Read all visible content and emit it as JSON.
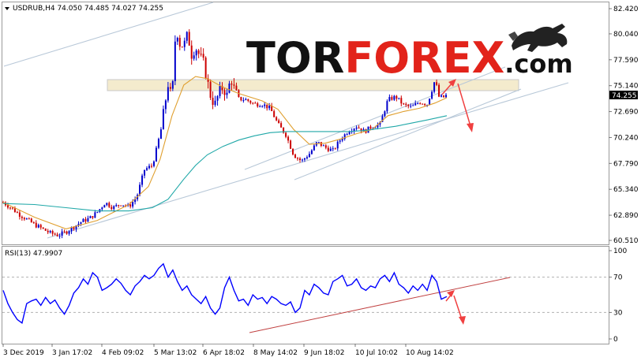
{
  "header": {
    "symbol_line": "USDRUB,H4  74.050 74.485 74.027 74.255",
    "rsi_label": "RSI(13) 47.9907"
  },
  "logo": {
    "part1": "TOR",
    "part2": "FOREX",
    "part3": ".com",
    "brand_color": "#e2231a"
  },
  "colors": {
    "bull_candle": "#0000cc",
    "bear_candle": "#cc0000",
    "ma_fast": "#e0a030",
    "ma_slow": "#20a8a8",
    "trendline": "#b8c8d8",
    "rsi_line": "#0000ff",
    "rsi_trend": "#c04040",
    "arrow": "#f04040",
    "resistance_zone": "#f0dca0",
    "current_price_bg": "#000000"
  },
  "chart_data": [
    {
      "type": "candlestick",
      "symbol": "USDRUB",
      "timeframe": "H4",
      "ohlc_last": {
        "open": 74.05,
        "high": 74.485,
        "low": 74.027,
        "close": 74.255
      },
      "current_price": "74.255",
      "y_ticks": [
        "82.420",
        "80.040",
        "77.590",
        "75.140",
        "72.690",
        "70.240",
        "67.790",
        "65.340",
        "62.890",
        "60.510"
      ],
      "ylim": [
        60.51,
        82.42
      ],
      "x_ticks": [
        "3 Dec 2019",
        "3 Jan 17:02",
        "4 Feb 09:02",
        "5 Mar 13:02",
        "6 Apr 18:02",
        "8 May 14:02",
        "9 Jun 18:02",
        "10 Jul 10:02",
        "10 Aug 14:02"
      ],
      "close_path": [
        [
          0,
          64.1
        ],
        [
          10,
          63.6
        ],
        [
          20,
          63.0
        ],
        [
          30,
          62.5
        ],
        [
          40,
          62.0
        ],
        [
          50,
          61.6
        ],
        [
          60,
          61.2
        ],
        [
          70,
          61.0
        ],
        [
          80,
          61.3
        ],
        [
          90,
          61.8
        ],
        [
          100,
          62.3
        ],
        [
          110,
          62.6
        ],
        [
          120,
          63.2
        ],
        [
          130,
          64.1
        ],
        [
          140,
          63.6
        ],
        [
          150,
          64.0
        ],
        [
          160,
          63.7
        ],
        [
          170,
          64.6
        ],
        [
          180,
          67.2
        ],
        [
          190,
          67.6
        ],
        [
          200,
          70.5
        ],
        [
          210,
          75.3
        ],
        [
          215,
          73.8
        ],
        [
          220,
          80.8
        ],
        [
          225,
          79.1
        ],
        [
          230,
          78.9
        ],
        [
          235,
          80.0
        ],
        [
          240,
          78.1
        ],
        [
          245,
          78.8
        ],
        [
          250,
          78.0
        ],
        [
          255,
          77.3
        ],
        [
          260,
          75.6
        ],
        [
          265,
          73.9
        ],
        [
          270,
          73.4
        ],
        [
          275,
          74.5
        ],
        [
          280,
          75.0
        ],
        [
          285,
          74.2
        ],
        [
          290,
          75.9
        ],
        [
          295,
          74.6
        ],
        [
          300,
          73.9
        ],
        [
          310,
          73.8
        ],
        [
          320,
          73.4
        ],
        [
          330,
          73.4
        ],
        [
          340,
          73.0
        ],
        [
          350,
          71.5
        ],
        [
          360,
          70.5
        ],
        [
          370,
          68.6
        ],
        [
          380,
          68.0
        ],
        [
          390,
          68.7
        ],
        [
          400,
          69.8
        ],
        [
          410,
          69.3
        ],
        [
          420,
          69.0
        ],
        [
          430,
          70.1
        ],
        [
          440,
          70.9
        ],
        [
          450,
          71.3
        ],
        [
          460,
          70.8
        ],
        [
          470,
          71.3
        ],
        [
          480,
          71.5
        ],
        [
          490,
          73.8
        ],
        [
          500,
          74.1
        ],
        [
          510,
          73.3
        ],
        [
          520,
          73.1
        ],
        [
          530,
          73.6
        ],
        [
          540,
          73.4
        ],
        [
          545,
          74.5
        ],
        [
          550,
          75.7
        ],
        [
          555,
          74.1
        ],
        [
          560,
          74.0
        ],
        [
          565,
          74.26
        ]
      ],
      "ma_fast_path": [
        [
          0,
          64.1
        ],
        [
          40,
          62.7
        ],
        [
          80,
          61.6
        ],
        [
          120,
          62.4
        ],
        [
          160,
          63.9
        ],
        [
          185,
          65.6
        ],
        [
          200,
          68.2
        ],
        [
          215,
          72.3
        ],
        [
          230,
          75.2
        ],
        [
          245,
          76.0
        ],
        [
          260,
          75.8
        ],
        [
          280,
          75.0
        ],
        [
          300,
          74.4
        ],
        [
          330,
          73.7
        ],
        [
          350,
          72.9
        ],
        [
          370,
          71.0
        ],
        [
          390,
          69.6
        ],
        [
          410,
          69.7
        ],
        [
          430,
          70.1
        ],
        [
          450,
          70.6
        ],
        [
          470,
          71.0
        ],
        [
          490,
          72.3
        ],
        [
          510,
          72.7
        ],
        [
          530,
          73.0
        ],
        [
          550,
          73.5
        ],
        [
          565,
          74.0
        ]
      ],
      "ma_slow_path": [
        [
          0,
          64.0
        ],
        [
          40,
          63.9
        ],
        [
          80,
          63.6
        ],
        [
          120,
          63.3
        ],
        [
          160,
          63.3
        ],
        [
          190,
          63.6
        ],
        [
          210,
          64.4
        ],
        [
          230,
          66.3
        ],
        [
          245,
          67.6
        ],
        [
          260,
          68.6
        ],
        [
          280,
          69.4
        ],
        [
          300,
          70.0
        ],
        [
          320,
          70.4
        ],
        [
          340,
          70.7
        ],
        [
          360,
          70.8
        ],
        [
          380,
          70.8
        ],
        [
          400,
          70.8
        ],
        [
          420,
          70.8
        ],
        [
          440,
          70.8
        ],
        [
          460,
          70.9
        ],
        [
          480,
          71.1
        ],
        [
          500,
          71.3
        ],
        [
          520,
          71.6
        ],
        [
          540,
          71.9
        ],
        [
          565,
          72.3
        ]
      ]
    },
    {
      "type": "line",
      "name": "RSI(13)",
      "current_value": 47.9907,
      "y_ticks": [
        "100",
        "70",
        "30",
        "0"
      ],
      "ylim": [
        0,
        100
      ],
      "levels": [
        70,
        30
      ],
      "values_path": [
        [
          0,
          55
        ],
        [
          6,
          40
        ],
        [
          12,
          30
        ],
        [
          18,
          22
        ],
        [
          24,
          18
        ],
        [
          30,
          40
        ],
        [
          36,
          43
        ],
        [
          42,
          45
        ],
        [
          48,
          38
        ],
        [
          54,
          47
        ],
        [
          60,
          40
        ],
        [
          66,
          44
        ],
        [
          72,
          35
        ],
        [
          78,
          28
        ],
        [
          84,
          38
        ],
        [
          90,
          52
        ],
        [
          96,
          58
        ],
        [
          102,
          68
        ],
        [
          108,
          62
        ],
        [
          114,
          75
        ],
        [
          120,
          70
        ],
        [
          126,
          55
        ],
        [
          132,
          58
        ],
        [
          138,
          62
        ],
        [
          144,
          68
        ],
        [
          150,
          63
        ],
        [
          156,
          55
        ],
        [
          162,
          50
        ],
        [
          168,
          60
        ],
        [
          174,
          65
        ],
        [
          180,
          72
        ],
        [
          186,
          68
        ],
        [
          192,
          72
        ],
        [
          198,
          80
        ],
        [
          204,
          85
        ],
        [
          210,
          70
        ],
        [
          216,
          78
        ],
        [
          222,
          65
        ],
        [
          228,
          55
        ],
        [
          234,
          60
        ],
        [
          240,
          50
        ],
        [
          246,
          45
        ],
        [
          252,
          40
        ],
        [
          258,
          48
        ],
        [
          264,
          35
        ],
        [
          270,
          28
        ],
        [
          276,
          35
        ],
        [
          282,
          58
        ],
        [
          288,
          70
        ],
        [
          294,
          55
        ],
        [
          300,
          43
        ],
        [
          306,
          45
        ],
        [
          312,
          38
        ],
        [
          318,
          50
        ],
        [
          324,
          45
        ],
        [
          330,
          47
        ],
        [
          336,
          40
        ],
        [
          342,
          48
        ],
        [
          348,
          45
        ],
        [
          354,
          40
        ],
        [
          360,
          38
        ],
        [
          366,
          42
        ],
        [
          372,
          30
        ],
        [
          378,
          35
        ],
        [
          384,
          55
        ],
        [
          390,
          50
        ],
        [
          396,
          62
        ],
        [
          402,
          58
        ],
        [
          408,
          52
        ],
        [
          414,
          50
        ],
        [
          420,
          65
        ],
        [
          426,
          68
        ],
        [
          432,
          72
        ],
        [
          438,
          60
        ],
        [
          444,
          62
        ],
        [
          450,
          68
        ],
        [
          456,
          58
        ],
        [
          462,
          55
        ],
        [
          468,
          60
        ],
        [
          474,
          58
        ],
        [
          480,
          68
        ],
        [
          486,
          72
        ],
        [
          492,
          65
        ],
        [
          498,
          75
        ],
        [
          504,
          62
        ],
        [
          510,
          58
        ],
        [
          516,
          52
        ],
        [
          522,
          60
        ],
        [
          528,
          55
        ],
        [
          534,
          62
        ],
        [
          540,
          55
        ],
        [
          546,
          72
        ],
        [
          552,
          65
        ],
        [
          558,
          45
        ],
        [
          565,
          48
        ]
      ]
    }
  ]
}
